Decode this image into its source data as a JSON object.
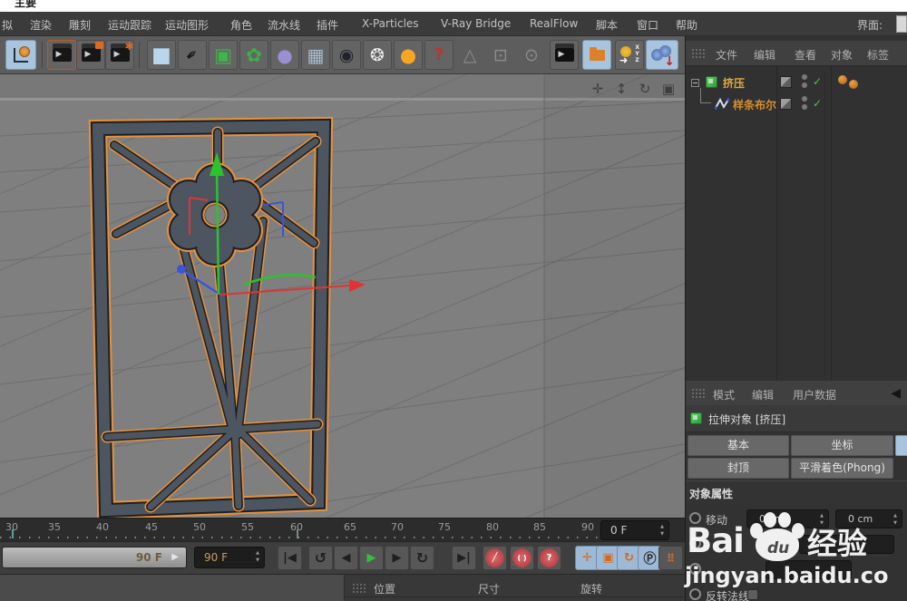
{
  "window": {
    "title_fragment": "主要",
    "interface_label": "界面:"
  },
  "colors": {
    "accent_orange": "#e8913a",
    "selection_yellow": "#e0a93e",
    "check_green": "#4cc24c",
    "highlight_blue": "#a9c4dd",
    "axis_x": "#e03434",
    "axis_y": "#2bc42b",
    "axis_z": "#3b55d9"
  },
  "glyphs": {
    "check": "✓",
    "spinner": "▲\n▼",
    "mode_arrow": "◀",
    "slider_arrow": "▶"
  },
  "menu": {
    "items": [
      "拟",
      "渲染",
      "雕刻",
      "运动跟踪",
      "运动图形",
      "角色",
      "流水线",
      "插件",
      "X-Particles",
      "V-Ray Bridge",
      "RealFlow",
      "脚本",
      "窗口",
      "帮助"
    ]
  },
  "toolbar": {
    "icons": [
      {
        "name": "coordinate-system",
        "glyph": ""
      },
      {
        "name": "render-view",
        "glyph": "▶"
      },
      {
        "name": "render-picture-viewer",
        "glyph": "▶"
      },
      {
        "name": "render-settings",
        "glyph": "✱"
      },
      {
        "name": "primitive-cube",
        "glyph": "■"
      },
      {
        "name": "spline-pen",
        "glyph": "✒"
      },
      {
        "name": "subdivision-surface",
        "glyph": "▣"
      },
      {
        "name": "generators-flower",
        "glyph": "✿"
      },
      {
        "name": "deformer",
        "glyph": "●"
      },
      {
        "name": "floor",
        "glyph": "▦"
      },
      {
        "name": "camera",
        "glyph": "◉"
      },
      {
        "name": "light",
        "glyph": "❂"
      },
      {
        "name": "material",
        "glyph": "●"
      },
      {
        "name": "help-cursor",
        "glyph": "?"
      },
      {
        "name": "snap-disabled",
        "glyph": "△"
      },
      {
        "name": "grid-disabled",
        "glyph": "⊡"
      },
      {
        "name": "view-grid-disabled",
        "glyph": "⊙"
      },
      {
        "name": "render-film",
        "glyph": "▶"
      },
      {
        "name": "content-browser",
        "glyph": ""
      },
      {
        "name": "coordinates-xyz",
        "glyph": "➜"
      },
      {
        "name": "xpresso-spheres",
        "glyph": "↓"
      }
    ]
  },
  "viewport": {
    "controls": [
      {
        "name": "pan",
        "glyph": "✛"
      },
      {
        "name": "zoom",
        "glyph": "↕"
      },
      {
        "name": "rotate",
        "glyph": "↻"
      },
      {
        "name": "toggle-view",
        "glyph": "▣"
      }
    ]
  },
  "object_manager": {
    "menu": [
      "文件",
      "编辑",
      "查看",
      "对象",
      "标签"
    ],
    "rows": [
      {
        "label": "挤压"
      },
      {
        "label": "样条布尔"
      }
    ]
  },
  "attributes": {
    "menu": [
      "模式",
      "编辑",
      "用户数据"
    ],
    "object_title": "拉伸对象 [挤压]",
    "tabs": [
      "基本",
      "坐标",
      "封顶",
      "平滑着色(Phong)"
    ],
    "section_title": "对象属性",
    "rows": {
      "move_label": "移动",
      "move_value_1": "0 cm",
      "move_value_2": "0 cm",
      "reverse_normals_label": "反转法线"
    }
  },
  "timeline": {
    "ruler_numbers": [
      "30",
      "35",
      "40",
      "45",
      "50",
      "55",
      "60",
      "65",
      "70",
      "75",
      "80",
      "85",
      "90"
    ],
    "current_frame_value": "0 F"
  },
  "transport": {
    "slider_value": "90 F",
    "end_frame_value": "90 F",
    "buttons": [
      {
        "name": "skip-start",
        "glyph": "|◀"
      },
      {
        "name": "loop-backward",
        "glyph": "↺"
      },
      {
        "name": "prev-frame",
        "glyph": "◀"
      },
      {
        "name": "play",
        "glyph": "▶"
      },
      {
        "name": "next-frame",
        "glyph": "▶"
      },
      {
        "name": "loop-forward",
        "glyph": "↻"
      },
      {
        "name": "skip-end",
        "glyph": "▶|"
      },
      {
        "name": "record-keyframe",
        "glyph": "╱"
      },
      {
        "name": "autokey",
        "glyph": "( )"
      },
      {
        "name": "keying-help",
        "glyph": "?"
      },
      {
        "name": "key-position",
        "glyph": "✛"
      },
      {
        "name": "key-scale",
        "glyph": "▣"
      },
      {
        "name": "key-rotation",
        "glyph": "↻"
      },
      {
        "name": "key-parameter",
        "glyph": "Ⓟ"
      },
      {
        "name": "key-pla",
        "glyph": "⠿"
      },
      {
        "name": "keyframe-selection",
        "glyph": "▥"
      }
    ]
  },
  "coordinate_bar": {
    "labels": [
      "位置",
      "尺寸",
      "旋转"
    ]
  },
  "watermark": {
    "brand_prefix": "Bai",
    "paw_text": "du",
    "brand_suffix": "经验",
    "url": "jingyan.baidu.co"
  }
}
